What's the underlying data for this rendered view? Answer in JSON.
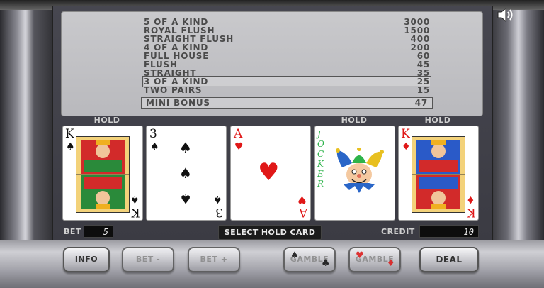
{
  "paytable": [
    {
      "hand": "5 OF A KIND",
      "payout": "3000"
    },
    {
      "hand": "ROYAL FLUSH",
      "payout": "1500"
    },
    {
      "hand": "STRAIGHT FLUSH",
      "payout": "400"
    },
    {
      "hand": "4 OF A KIND",
      "payout": "200"
    },
    {
      "hand": "FULL HOUSE",
      "payout": "60"
    },
    {
      "hand": "FLUSH",
      "payout": "45"
    },
    {
      "hand": "STRAIGHT",
      "payout": "35"
    },
    {
      "hand": "3 OF A KIND",
      "payout": "25",
      "highlighted": true
    },
    {
      "hand": "TWO PAIRS",
      "payout": "15"
    }
  ],
  "mini_bonus": {
    "label": "MINI BONUS",
    "value": "47"
  },
  "hold_label": "HOLD",
  "cards": [
    {
      "rank": "K",
      "suit": "spades",
      "held": true
    },
    {
      "rank": "3",
      "suit": "spades",
      "held": false
    },
    {
      "rank": "A",
      "suit": "hearts",
      "held": false
    },
    {
      "rank": "JOCKER",
      "suit": "joker",
      "held": true
    },
    {
      "rank": "K",
      "suit": "diamonds",
      "held": true
    }
  ],
  "status": {
    "bet_label": "BET",
    "bet_value": "5",
    "message": "SELECT HOLD CARD",
    "credit_label": "CREDIT",
    "credit_value": "10"
  },
  "buttons": {
    "info": "INFO",
    "bet_minus": "BET -",
    "bet_plus": "BET +",
    "gamble_black": "GAMBLE",
    "gamble_red": "GAMBLE",
    "deal": "DEAL"
  },
  "colors": {
    "red_suit": "#e01818",
    "black_suit": "#111111",
    "joker_text": "#2db34a"
  },
  "icons": [
    "speaker-icon",
    "spade-icon",
    "club-icon",
    "heart-icon",
    "diamond-icon"
  ]
}
